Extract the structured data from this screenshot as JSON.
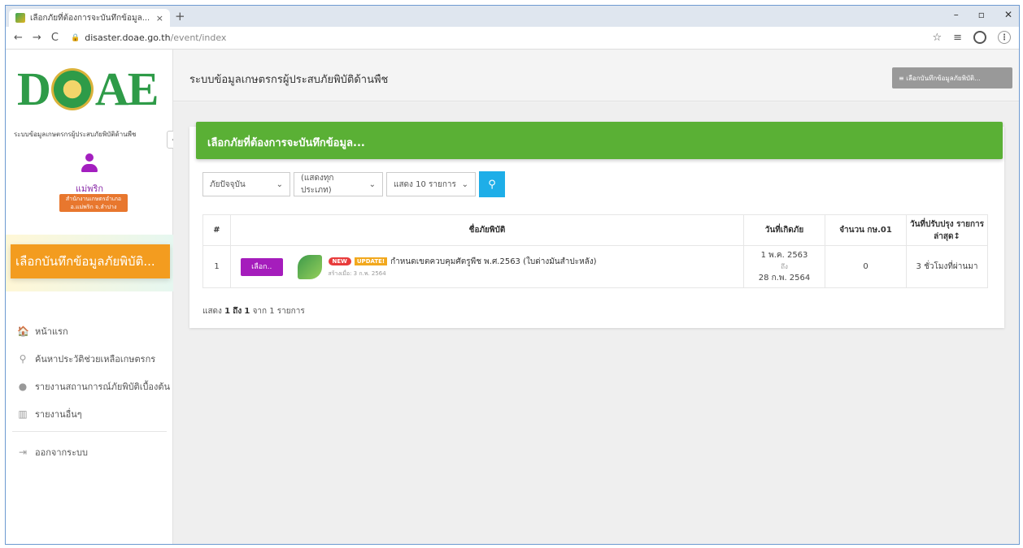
{
  "browser": {
    "tab_title": "เลือกภัยที่ต้องการจะบันทึกข้อมูล... - ระ",
    "tab_close": "×",
    "new_tab": "+",
    "url_host": "disaster.doae.go.th",
    "url_path": "/event/index",
    "win_min": "–",
    "win_max": "▫",
    "win_close": "✕"
  },
  "sidebar": {
    "logo_left": "D",
    "logo_right": "AE",
    "system_title": "ระบบข้อมูลเกษตรกรผู้ประสบภัยพิบัติด้านพืช",
    "user_name": "แม่พริก",
    "office_line1": "สำนักงานเกษตรอำเภอ",
    "office_line2": "อ.แม่พริก จ.ลำปาง",
    "record_button": "เลือกบันทึกข้อมูลภัยพิบัติ...",
    "menu": [
      {
        "icon": "🏠",
        "label": "หน้าแรก"
      },
      {
        "icon": "⚲",
        "label": "ค้นหาประวัติช่วยเหลือเกษตรกร"
      },
      {
        "icon": "●",
        "label": "รายงานสถานการณ์ภัยพิบัติเบื้องต้น"
      },
      {
        "icon": "▥",
        "label": "รายงานอื่นๆ"
      }
    ],
    "logout": {
      "icon": "⇥",
      "label": "ออกจากระบบ"
    }
  },
  "header": {
    "title": "ระบบข้อมูลเกษตรกรผู้ประสบภัยพิบัติด้านพืช",
    "button_label": "≡ เลือกบันทึกข้อมูลภัยพิบัติ..."
  },
  "card": {
    "title": "เลือกภัยที่ต้องการจะบันทึกข้อมูล...",
    "filters": {
      "disaster": "ภัยปัจจุบัน",
      "type": "(แสดงทุกประเภท)",
      "page_size": "แสดง 10 รายการ"
    },
    "columns": [
      "#",
      "ชื่อภัยพิบัติ",
      "วันที่เกิดภัย",
      "จำนวน กษ.01",
      "วันที่ปรับปรุง รายการล่าสุด↕"
    ],
    "rows": [
      {
        "no": "1",
        "select_label": "เลือก..",
        "badge_new": "NEW",
        "badge_update": "UPDATE!",
        "name": "กำหนดเขตควบคุมศัตรูพืช พ.ศ.2563 (ใบด่างมันสำปะหลัง)",
        "created": "สร้างเมื่อ: 3 ก.พ. 2564",
        "date_start": "1 พ.ค. 2563",
        "date_to": "ถึง",
        "date_end": "28 ก.พ. 2564",
        "count": "0",
        "updated": "3 ชั่วโมงที่ผ่านมา"
      }
    ],
    "info": {
      "prefix": "แสดง",
      "from": "1",
      "to_word": "ถึง",
      "to": "1",
      "of": "จาก 1 รายการ"
    }
  },
  "colors": {
    "brand_green": "#2e9b48",
    "card_header": "#5ab035",
    "record_button": "#f39c1f",
    "select_button": "#a51dbc",
    "search_button": "#1eaee8"
  }
}
